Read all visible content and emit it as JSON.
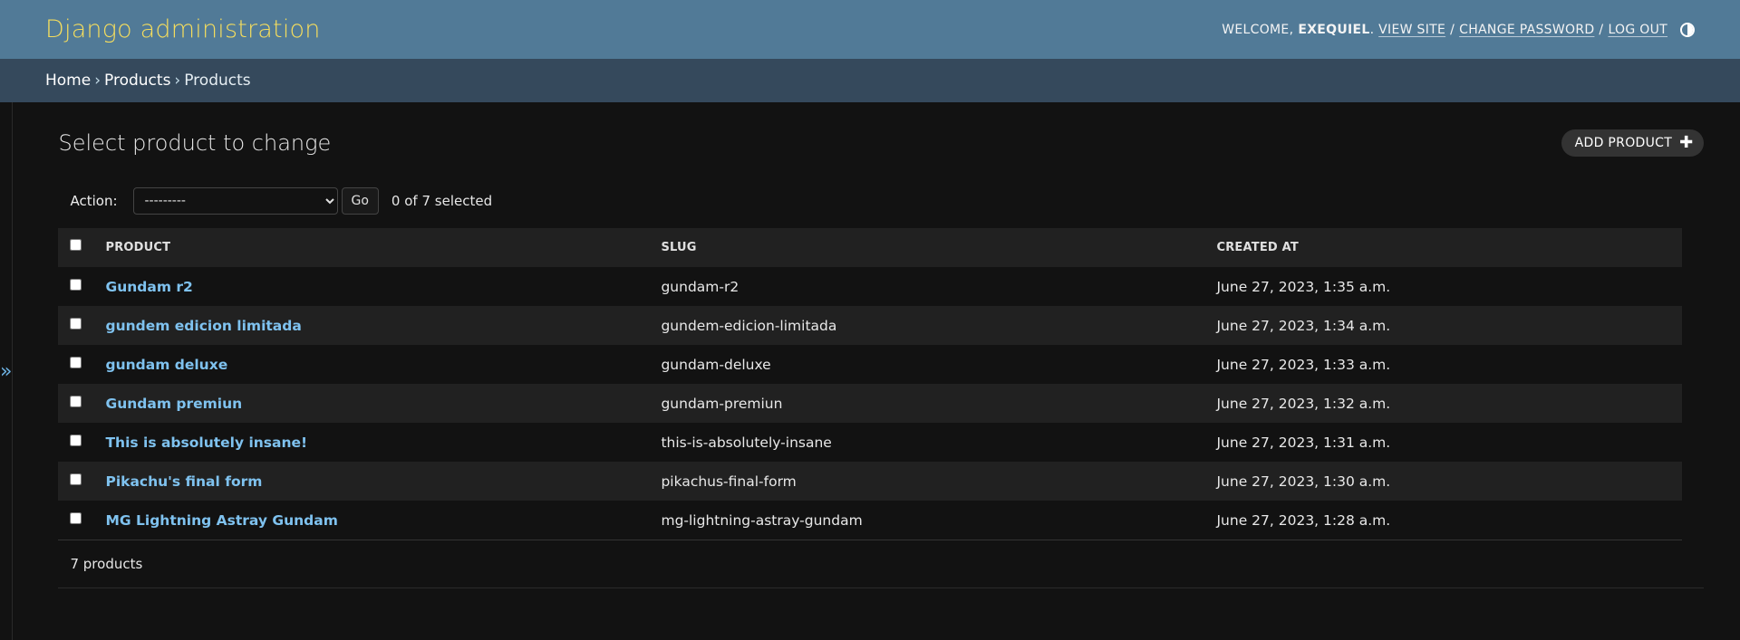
{
  "header": {
    "brand": "Django administration",
    "welcome": "WELCOME,",
    "username": "EXEQUIEL",
    "view_site": "VIEW SITE",
    "change_password": "CHANGE PASSWORD",
    "log_out": "LOG OUT"
  },
  "breadcrumbs": {
    "home": "Home",
    "app": "Products",
    "current": "Products"
  },
  "sidebar": {
    "toggle": "»"
  },
  "page": {
    "title": "Select product to change",
    "add_button": "ADD PRODUCT",
    "add_icon": "✚"
  },
  "actions": {
    "label": "Action:",
    "selected_option": "---------",
    "go": "Go",
    "selected_count": "0 of 7 selected"
  },
  "table": {
    "columns": [
      "PRODUCT",
      "SLUG",
      "CREATED AT"
    ],
    "rows": [
      {
        "product": "Gundam r2",
        "slug": "gundam-r2",
        "created": "June 27, 2023, 1:35 a.m."
      },
      {
        "product": "gundem edicion limitada",
        "slug": "gundem-edicion-limitada",
        "created": "June 27, 2023, 1:34 a.m."
      },
      {
        "product": "gundam deluxe",
        "slug": "gundam-deluxe",
        "created": "June 27, 2023, 1:33 a.m."
      },
      {
        "product": "Gundam premiun",
        "slug": "gundam-premiun",
        "created": "June 27, 2023, 1:32 a.m."
      },
      {
        "product": "This is absolutely insane!",
        "slug": "this-is-absolutely-insane",
        "created": "June 27, 2023, 1:31 a.m."
      },
      {
        "product": "Pikachu's final form",
        "slug": "pikachus-final-form",
        "created": "June 27, 2023, 1:30 a.m."
      },
      {
        "product": "MG Lightning Astray Gundam",
        "slug": "mg-lightning-astray-gundam",
        "created": "June 27, 2023, 1:28 a.m."
      }
    ]
  },
  "paginator": {
    "count": "7 products"
  },
  "colors": {
    "header_bg": "#517a97",
    "brand": "#f5dd5d",
    "breadcrumbs_bg": "#35495c",
    "link": "#7fc2ef",
    "page_bg": "#121212",
    "row_alt": "#212121"
  }
}
